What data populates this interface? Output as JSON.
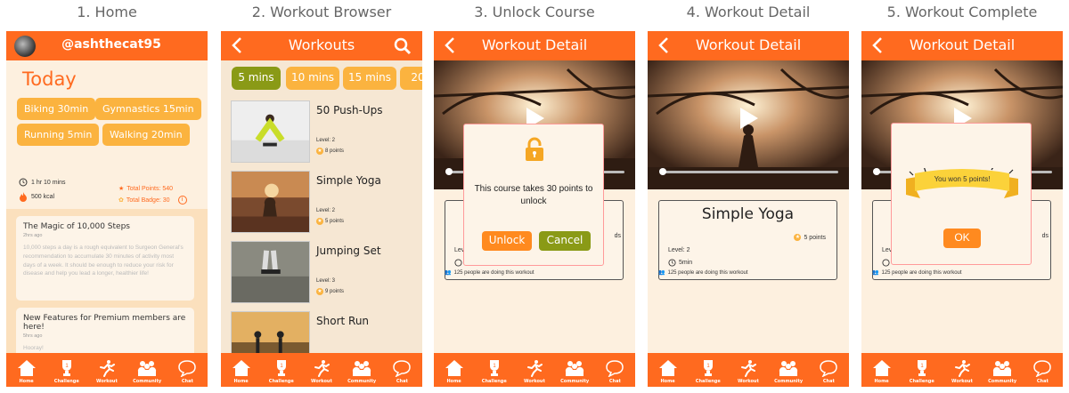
{
  "captions": [
    "1. Home",
    "2. Workout Browser",
    "3. Unlock Course",
    "4. Workout Detail",
    "5. Workout Complete"
  ],
  "nav": [
    "Home",
    "Challenge",
    "Workout",
    "Community",
    "Chat"
  ],
  "home": {
    "username": "@ashthecat95",
    "today": "Today",
    "activities": [
      "Biking  30min",
      "Gymnastics  15min",
      "Running  5min",
      "Walking  20min"
    ],
    "duration": "1 hr 10 mins",
    "calories": "500 kcal",
    "total_points": "Total Points: 540",
    "total_badge": "Total Badge: 30",
    "info": "i",
    "articles": [
      {
        "title": "The Magic of 10,000 Steps",
        "date": "2hrs ago",
        "body": "10,000 steps a day is a rough equivalent to Surgeon General's recommendation to accumulate 30 minutes of activity most days of a week. It should be enough to reduce your risk for disease and help you lead a longer, healthier life!"
      },
      {
        "title": "New Features for Premium members are here!",
        "date": "5hrs ago",
        "body": "Hooray!"
      }
    ]
  },
  "browser": {
    "title": "Workouts",
    "tabs": [
      "5 mins",
      "10 mins",
      "15 mins",
      "20"
    ],
    "workouts": [
      {
        "name": "50 Push-Ups",
        "level": "Level: 2",
        "points": "8 points"
      },
      {
        "name": "Simple Yoga",
        "level": "Level: 2",
        "points": "5 points"
      },
      {
        "name": "Jumping Set",
        "level": "Level: 3",
        "points": "9 points"
      },
      {
        "name": "Short Run",
        "level": "",
        "points": ""
      }
    ]
  },
  "detail": {
    "title": "Workout Detail",
    "workout_name": "Simple Yoga",
    "points": "5 points",
    "level": "Level: 2",
    "time": "5min",
    "people": "125 people are doing this workout",
    "partial_points": "ds",
    "partial_level": "Lev"
  },
  "unlock": {
    "message": "This course takes 30 points to unlock",
    "unlock_label": "Unlock",
    "cancel_label": "Cancel"
  },
  "complete": {
    "message": "You won 5 points!",
    "ok_label": "OK"
  },
  "colors": {
    "accent": "#ff6a1f",
    "chip": "#fbb33f",
    "active_tab": "#8a9a16",
    "cancel": "#8a9a16"
  }
}
